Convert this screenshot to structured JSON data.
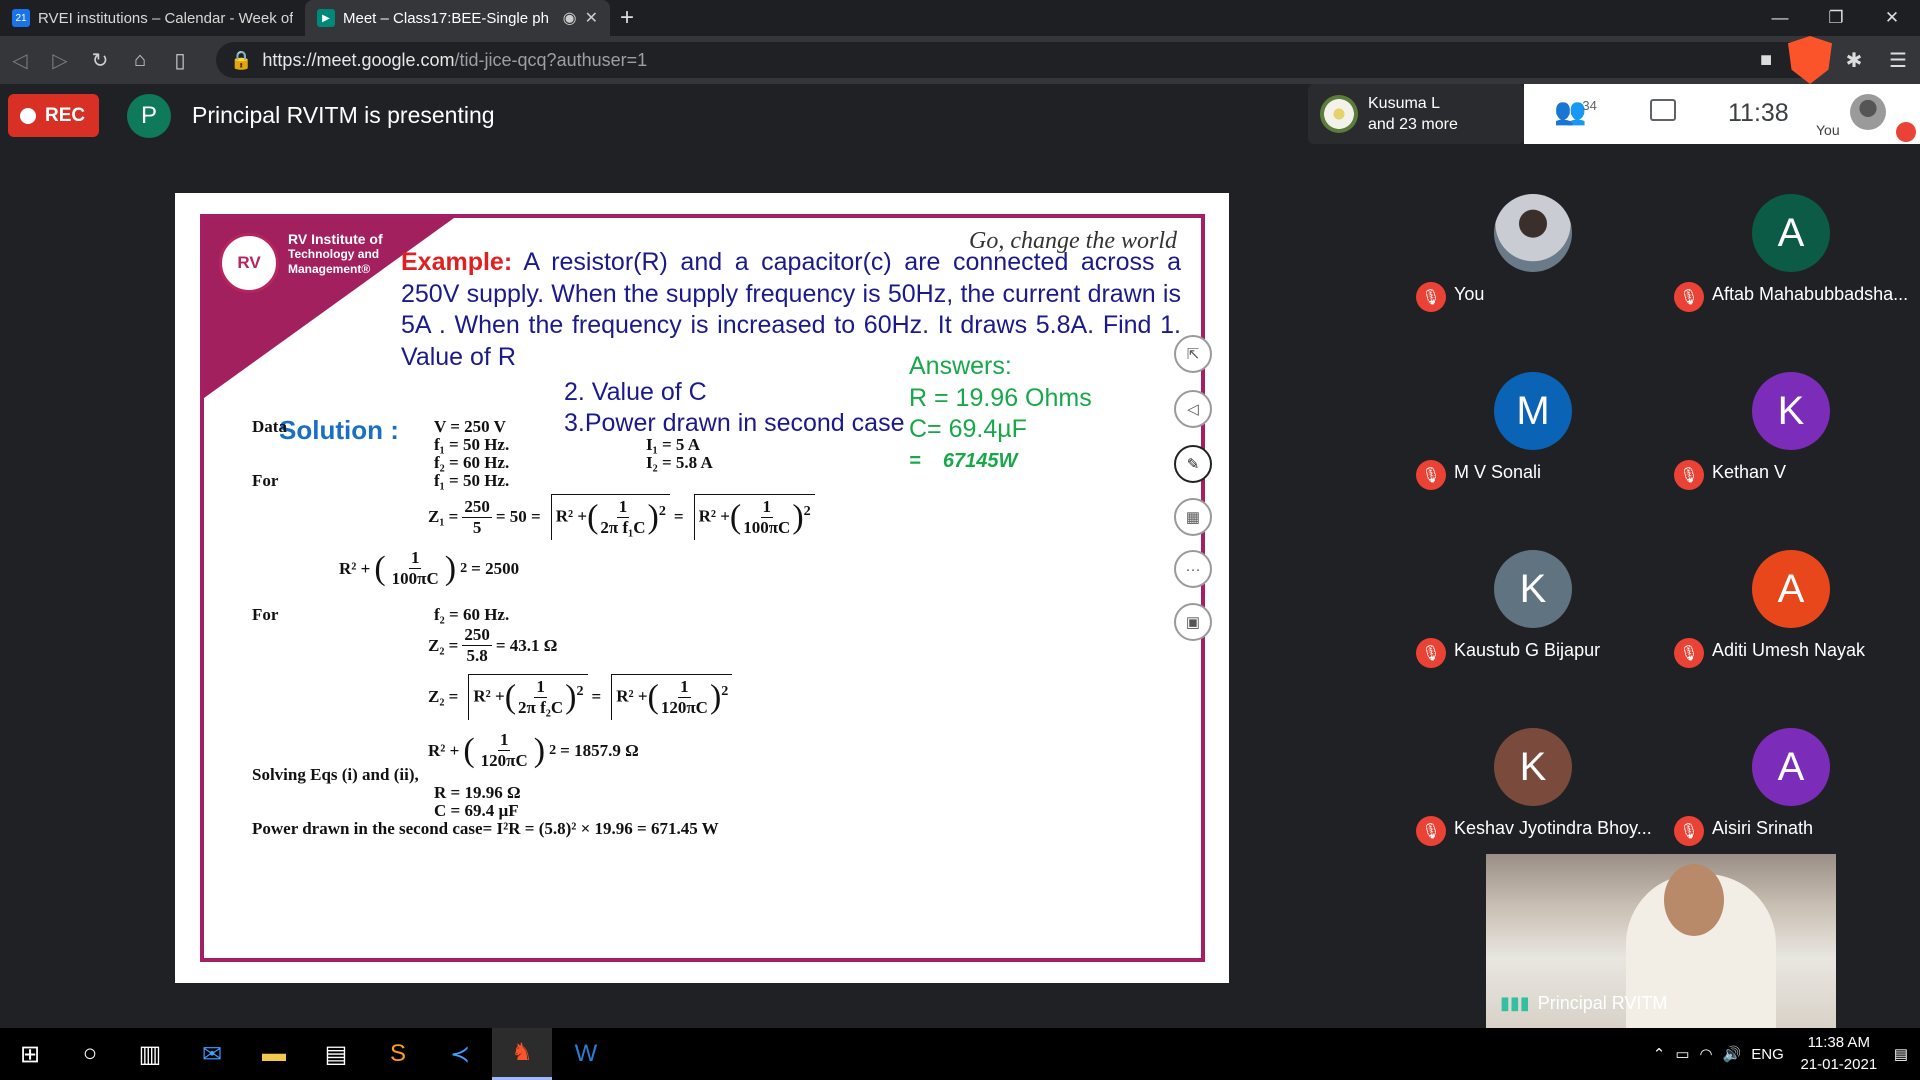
{
  "browser": {
    "tabs": [
      {
        "label": "RVEI institutions – Calendar - Week of",
        "favicon": "21"
      },
      {
        "label": "Meet – Class17:BEE-Single ph"
      }
    ],
    "new_tab": "+",
    "url_host": "https://meet.google.com",
    "url_rest": "/tid-jice-qcq?authuser=1"
  },
  "meet": {
    "rec_label": "REC",
    "presenter_initial": "P",
    "presenting_text": "Principal RVITM is presenting",
    "speaker_line1": "Kusuma L",
    "speaker_line2": "and 23 more",
    "people_count": "34",
    "time": "11:38",
    "you_label": "You"
  },
  "slide": {
    "institute_line1": "RV Institute of",
    "institute_line2": "Technology and",
    "institute_line3": "Management®",
    "logo_text": "RV",
    "tagline": "Go, change the world",
    "example_label": "Example:",
    "question": "A resistor(R) and a capacitor(c) are connected across a 250V supply. When the supply frequency is 50Hz, the current drawn is 5A . When the frequency is increased to 60Hz. It draws 5.8A. Find 1. Value of R",
    "find2": "2. Value of C",
    "find3": "3.Power drawn in second case",
    "answers_title": "Answers:",
    "answer_r": "R = 19.96 Ohms",
    "answer_c": "C= 69.4µF",
    "answer_p_sym": "=",
    "answer_p": "67145W",
    "solution": "Solution :",
    "data_label": "Data",
    "for1": "For",
    "for2": "For",
    "v": "V = 250 V",
    "f1": "f₁ = 50 Hz.",
    "f2": "f₂ = 60 Hz.",
    "f1b": "f₁ = 50 Hz.",
    "i1": "I₁ = 5 A",
    "i2": "I₂ = 5.8 A",
    "z1_lhs": "Z₁ =",
    "z1_num": "250",
    "z1_den": "5",
    "z1_eq": "= 50 =",
    "r2_plus": "R² +",
    "one": "1",
    "two_pi_f1c": "2π f₁C",
    "hundred_pi_c": "100πC",
    "eq_2500": "= 2500",
    "f2b": "f₂ = 60 Hz.",
    "z2_lhs": "Z₂ =",
    "z2_num": "250",
    "z2_den": "5.8",
    "z2_val": "= 43.1 Ω",
    "two_pi_f2c": "2π f₂C",
    "onetwenty_pi_c": "120πC",
    "eq_1857": "= 1857.9 Ω",
    "solving": "Solving Eqs (i) and (ii),",
    "r_result": "R = 19.96 Ω",
    "c_result": "C = 69.4 µF",
    "power_line": "Power drawn in the second case= I²R = (5.8)² × 19.96 = 671.45 W"
  },
  "participants": [
    {
      "name": "You",
      "initial": "",
      "color": "#5a6b78"
    },
    {
      "name": "Aftab Mahabubbadsha...",
      "initial": "A",
      "color": "#0b5b46"
    },
    {
      "name": "M V Sonali",
      "initial": "M",
      "color": "#0a63b5"
    },
    {
      "name": "Kethan V",
      "initial": "K",
      "color": "#7b2cb8"
    },
    {
      "name": "Kaustub G Bijapur",
      "initial": "K",
      "color": "#5f7480"
    },
    {
      "name": "Aditi Umesh Nayak",
      "initial": "A",
      "color": "#e8471c"
    },
    {
      "name": "Keshav Jyotindra Bhoy...",
      "initial": "K",
      "color": "#7a4b3d"
    },
    {
      "name": "Aisiri Srinath",
      "initial": "A",
      "color": "#7b2cb8"
    }
  ],
  "pip_name": "Principal RVITM",
  "taskbar": {
    "lang": "ENG",
    "time": "11:38 AM",
    "date": "21-01-2021"
  }
}
